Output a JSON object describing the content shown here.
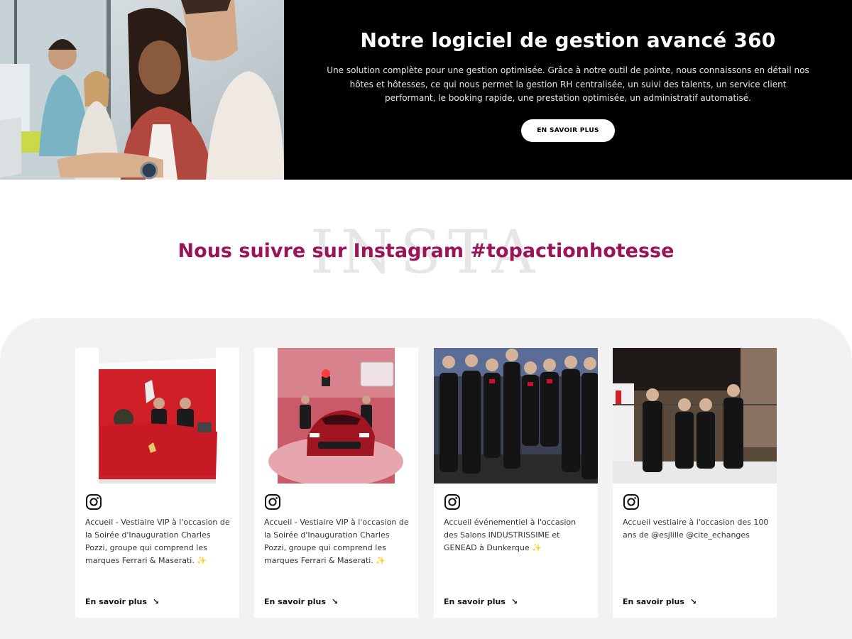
{
  "hero": {
    "title": "Notre logiciel de gestion avancé 360",
    "description": "Une solution complète pour une gestion optimisée. Grâce à notre outil de pointe, nous connaissons en détail nos hôtes et hôtesses, ce qui nous permet la gestion RH centralisée, un suivi des talents, un service client performant, le booking rapide, une prestation optimisée, un administratif automatisé.",
    "button_label": "EN SAVOIR PLUS"
  },
  "instagram": {
    "background_word": "INSTA",
    "title": "Nous suivre sur Instagram #topactionhotesse",
    "title_color": "#9b1458",
    "posts": [
      {
        "icon": "instagram-icon",
        "caption": "Accueil - Vestiaire VIP à l'occasion de la Soirée d'Inauguration Charles Pozzi, groupe qui comprend les marques Ferrari & Maserati. ✨",
        "link": "En savoir plus",
        "link_icon": "↘"
      },
      {
        "icon": "instagram-icon",
        "caption": "Accueil - Vestiaire VIP à l'occasion de la Soirée d'Inauguration Charles Pozzi, groupe qui comprend les marques Ferrari & Maserati. ✨",
        "link": "En savoir plus",
        "link_icon": "↘"
      },
      {
        "icon": "instagram-icon",
        "caption": "Accueil événementiel à l'occasion des Salons INDUSTRISSIME et GENEAD à Dunkerque ✨",
        "link": "En savoir plus",
        "link_icon": "↘"
      },
      {
        "icon": "instagram-icon",
        "caption": "Accueil vestiaire à l'occasion des 100 ans de @esjlille @cite_echanges",
        "link": "En savoir plus",
        "link_icon": "↘"
      }
    ]
  },
  "colors": {
    "accent": "#9b1458",
    "hero_bg": "#000000",
    "panel_bg": "#f2f2f2",
    "ferrari_red": "#d21f2a"
  }
}
